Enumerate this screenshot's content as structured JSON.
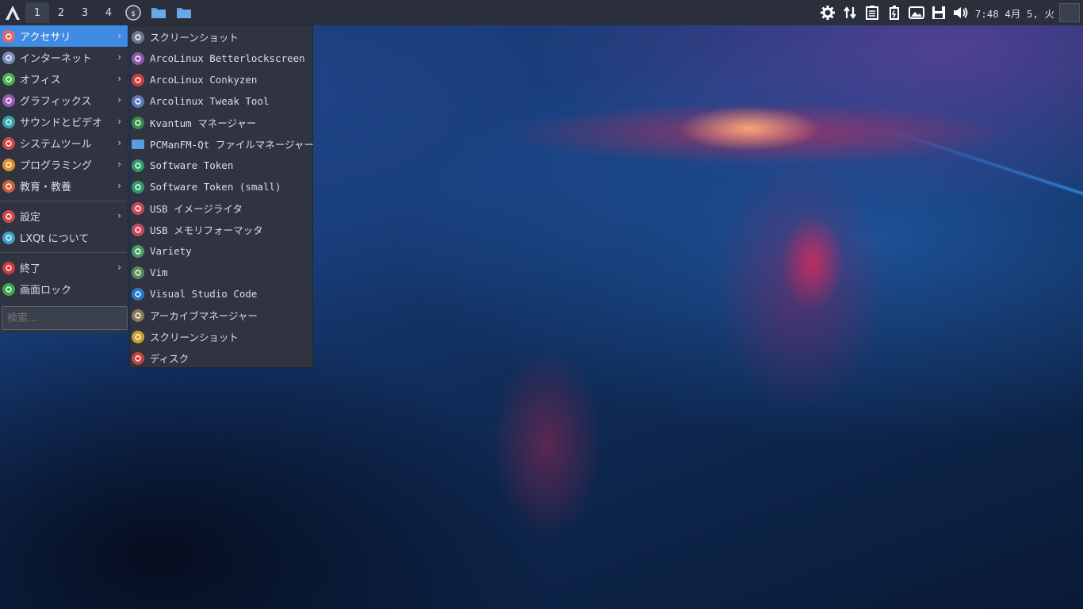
{
  "panel": {
    "workspaces": [
      "1",
      "2",
      "3",
      "4"
    ],
    "active_workspace": "1",
    "clock": "7:48 4月 5, 火",
    "colors": {
      "panel_bg": "#2a2f3b",
      "accent": "#3f8ae2"
    },
    "icons": [
      "arcolinux-logo-icon",
      "terminal-icon",
      "folder-icon",
      "folder-icon",
      "settings-gear-icon",
      "network-arrows-icon",
      "clipboard-icon",
      "battery-icon",
      "image-viewer-icon",
      "save-icon",
      "volume-icon",
      "show-desktop-icon"
    ]
  },
  "menu": {
    "categories": [
      {
        "label": "アクセサリ",
        "icon": "accessories-icon",
        "color": "#e06a6a",
        "submenu": true,
        "selected": true
      },
      {
        "label": "インターネット",
        "icon": "internet-icon",
        "color": "#7b8fb8",
        "submenu": true
      },
      {
        "label": "オフィス",
        "icon": "office-icon",
        "color": "#4caf50",
        "submenu": true
      },
      {
        "label": "グラフィックス",
        "icon": "graphics-icon",
        "color": "#9b59b6",
        "submenu": true
      },
      {
        "label": "サウンドとビデオ",
        "icon": "multimedia-icon",
        "color": "#3aa3a8",
        "submenu": true
      },
      {
        "label": "システムツール",
        "icon": "system-tools-icon",
        "color": "#d04848",
        "submenu": true
      },
      {
        "label": "プログラミング",
        "icon": "programming-icon",
        "color": "#e0902a",
        "submenu": true
      },
      {
        "label": "教育・教養",
        "icon": "education-icon",
        "color": "#d0603a",
        "submenu": true
      }
    ],
    "settings": [
      {
        "label": "設定",
        "icon": "settings-icon",
        "color": "#d04848",
        "submenu": true
      },
      {
        "label": "LXQt について",
        "icon": "info-icon",
        "color": "#3aa3c8",
        "submenu": false
      }
    ],
    "session": [
      {
        "label": "終了",
        "icon": "power-icon",
        "color": "#d03a3a",
        "submenu": true
      },
      {
        "label": "画面ロック",
        "icon": "lock-icon",
        "color": "#3aa84a",
        "submenu": false
      }
    ],
    "search_placeholder": "検索..."
  },
  "submenu": {
    "items": [
      {
        "label": "スクリーンショット",
        "icon": "screenshot-icon",
        "color": "#6b7a90"
      },
      {
        "label": "ArcoLinux Betterlockscreen",
        "icon": "betterlockscreen-icon",
        "color": "#8a5aa8"
      },
      {
        "label": "ArcoLinux Conkyzen",
        "icon": "conkyzen-icon",
        "color": "#c84040"
      },
      {
        "label": "Arcolinux Tweak Tool",
        "icon": "tweak-tool-icon",
        "color": "#5a7ab8"
      },
      {
        "label": "Kvantum マネージャー",
        "icon": "kvantum-icon",
        "color": "#3a8a4a"
      },
      {
        "label": "PCManFM-Qt ファイルマネージャー",
        "icon": "folder-icon",
        "color": "#5b9be0"
      },
      {
        "label": "Software Token",
        "icon": "software-token-icon",
        "color": "#2f9a6a"
      },
      {
        "label": "Software Token (small)",
        "icon": "software-token-icon",
        "color": "#2f9a6a"
      },
      {
        "label": "USB イメージライタ",
        "icon": "usb-writer-icon",
        "color": "#c84a5a"
      },
      {
        "label": "USB メモリフォーマッタ",
        "icon": "usb-formatter-icon",
        "color": "#c84a5a"
      },
      {
        "label": "Variety",
        "icon": "variety-icon",
        "color": "#4a9a6a"
      },
      {
        "label": "Vim",
        "icon": "vim-icon",
        "color": "#5a8a5a"
      },
      {
        "label": "Visual Studio Code",
        "icon": "vscode-icon",
        "color": "#2a78c8"
      },
      {
        "label": "アーカイブマネージャー",
        "icon": "archive-manager-icon",
        "color": "#8a7a5a"
      },
      {
        "label": "スクリーンショット",
        "icon": "screenshot-icon",
        "color": "#c8a030"
      },
      {
        "label": "ディスク",
        "icon": "disks-icon",
        "color": "#c84040"
      }
    ]
  }
}
